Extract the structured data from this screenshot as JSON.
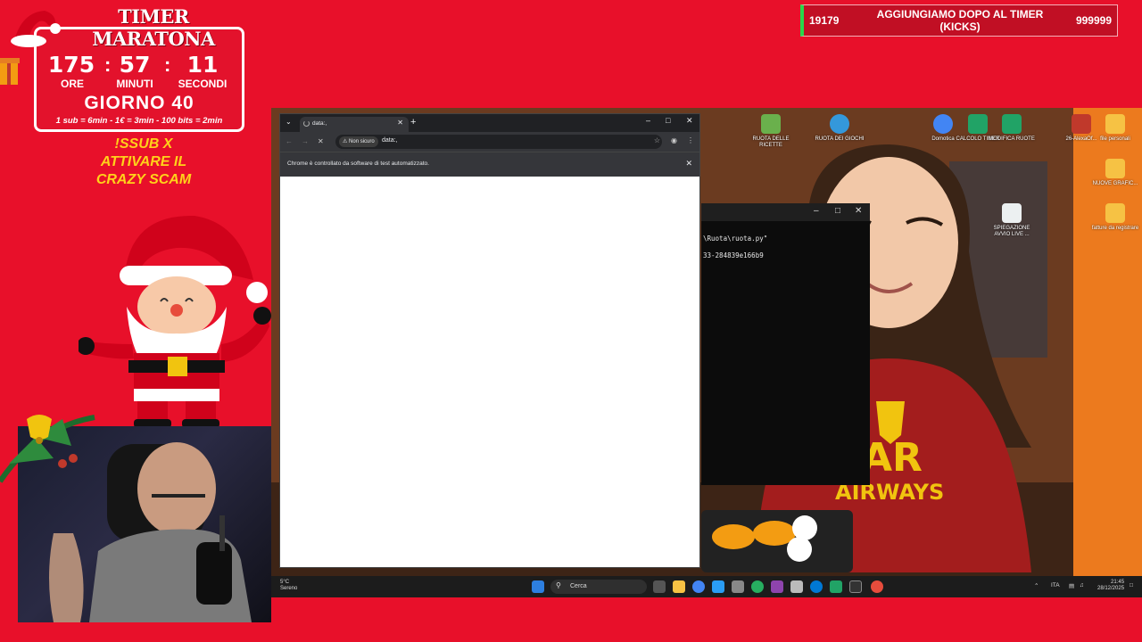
{
  "overlay": {
    "timer_title": "TIMER MARATONA",
    "hours": "175",
    "minutes": "57",
    "seconds": "11",
    "hours_label": "ORE",
    "minutes_label": "MINUTI",
    "seconds_label": "SECONDI",
    "day": "GIORNO 40",
    "rates": "1 sub = 6min - 1€ = 3min - 100 bits = 2min",
    "promo": [
      "!SSUB X",
      "ATTIVARE IL",
      "CRAZY SCAM"
    ]
  },
  "goal": {
    "current": "19179",
    "text": "AGGIUNGIAMO DOPO AL TIMER (KICKS)",
    "target": "999999"
  },
  "desktop_icons": [
    {
      "label": "RUOTA DELLE RICETTE",
      "color": "#6ab04c"
    },
    {
      "label": "RUOTA DEI GIOCHI",
      "color": "#3498db"
    },
    {
      "label": "Domotica",
      "color": "#4285f4"
    },
    {
      "label": "CALCOLO TIMER",
      "color": "#21a366"
    },
    {
      "label": "MODIFICA RUOTE",
      "color": "#21a366"
    },
    {
      "label": "26-AlexaOf...",
      "color": "#c0392b"
    },
    {
      "label": "file personali",
      "color": "#f6c244"
    },
    {
      "label": "NUOVE GRAFIC...",
      "color": "#f6c244"
    },
    {
      "label": "SPIEGAZIONE AVVIO LIVE ...",
      "color": "#ecf0f1"
    },
    {
      "label": "fatture da registrare",
      "color": "#f6c244"
    }
  ],
  "terminal": {
    "line1": "\\Ruota\\ruota.py\"",
    "line2": "33-284839e166b9"
  },
  "chrome": {
    "tab_title": "data:,",
    "url_warning": "Non sicuro",
    "url": "data:,",
    "infobar": "Chrome è controllato da software di test automatizzato."
  },
  "taskbar": {
    "temp": "5°C",
    "weather": "Sereno",
    "search_placeholder": "Cerca",
    "lang": "ITA",
    "time": "21:45",
    "date": "28/12/2025"
  },
  "colors": {
    "background": "#e8102a",
    "promo_yellow": "#ffd21a",
    "goal_accent": "#27d84a"
  }
}
